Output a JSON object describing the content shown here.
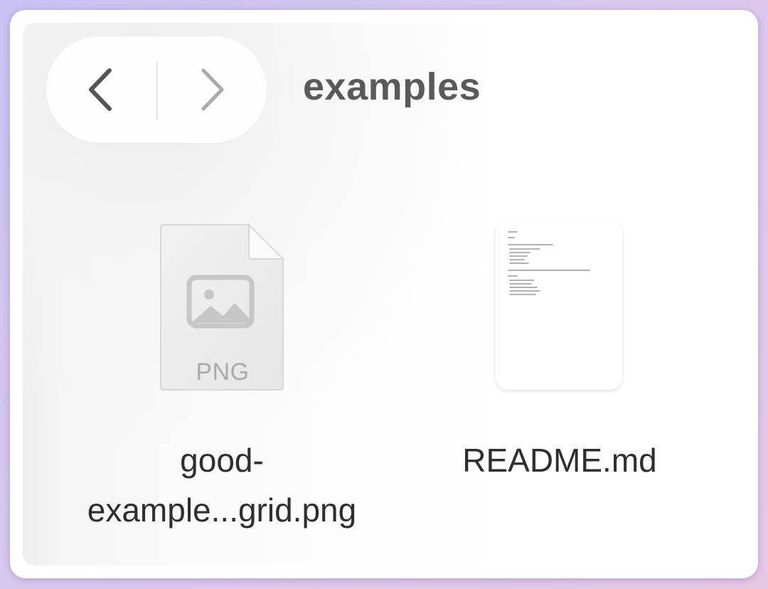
{
  "window": {
    "folder_title": "examples"
  },
  "navigation": {
    "back_icon": "chevron-left-icon",
    "forward_icon": "chevron-right-icon"
  },
  "files": [
    {
      "name_line1": "good-",
      "name_line2": "example...grid.png",
      "type_label": "PNG",
      "icon": "image-file-icon"
    },
    {
      "name_line1": "README.md",
      "icon": "document-thumbnail"
    }
  ],
  "colors": {
    "background_gradient_start": "#c9c2f2",
    "background_gradient_end": "#e6c8e6",
    "window": "#ffffff",
    "title_text": "#5a5a5a",
    "file_name_text": "#2e2e2e"
  }
}
